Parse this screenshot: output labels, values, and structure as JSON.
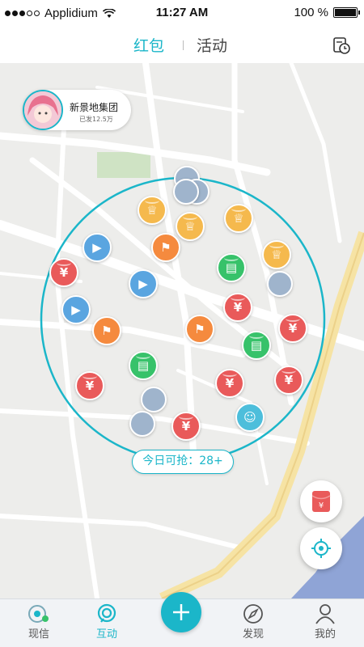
{
  "status_bar": {
    "carrier": "Applidium",
    "time": "11:27 AM",
    "battery": "100 %",
    "battery_level": 1.0
  },
  "header": {
    "tabs": [
      {
        "label": "红包",
        "active": true
      },
      {
        "label": "活动",
        "active": false
      }
    ],
    "history_icon": "history-clock-icon"
  },
  "map": {
    "publisher": {
      "name": "新景地集团",
      "sent": "已发12.5万"
    },
    "today_count": "今日可抢：28+",
    "red_packet_symbol": "¥"
  },
  "fabs": {
    "red_packet": {
      "icon": "red-packet-icon",
      "label": "¥"
    },
    "locate": {
      "icon": "locate-icon"
    }
  },
  "bottom_nav": {
    "items": [
      {
        "label": "现信",
        "icon": "chat-icon"
      },
      {
        "label": "互动",
        "icon": "interact-icon",
        "active": true
      },
      {
        "label": "发现",
        "icon": "compass-icon"
      },
      {
        "label": "我的",
        "icon": "person-icon"
      }
    ],
    "center_icon": "plus-icon"
  },
  "colors": {
    "accent": "#1bb6c9",
    "red": "#e95a5a",
    "yellow": "#f5b94d",
    "orange": "#f58a3e",
    "green": "#37c26a",
    "blue": "#5aa5e0"
  }
}
